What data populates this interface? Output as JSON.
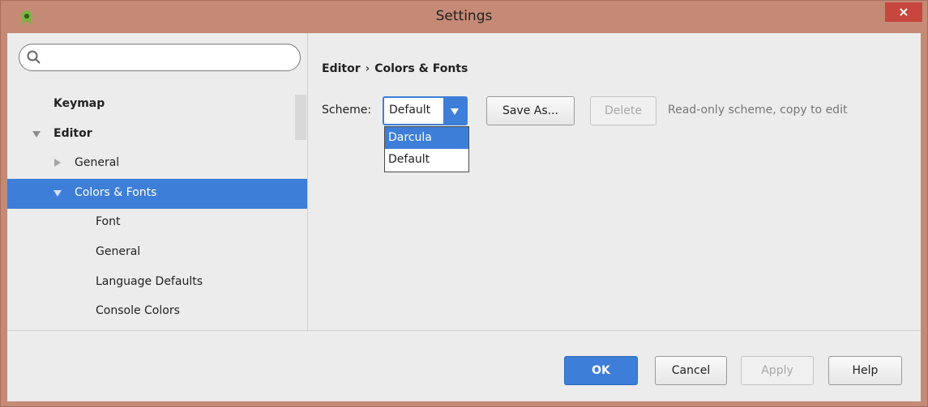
{
  "window": {
    "title": "Settings",
    "close_glyph": "×",
    "icon": "android-robot-icon"
  },
  "search": {
    "value": "",
    "placeholder": ""
  },
  "tree": {
    "keymap": "Keymap",
    "editor": "Editor",
    "general": "General",
    "colors_fonts": "Colors & Fonts",
    "font": "Font",
    "general2": "General",
    "language_defaults": "Language Defaults",
    "console_colors": "Console Colors"
  },
  "breadcrumb": {
    "parent": "Editor",
    "separator": "›",
    "current": "Colors & Fonts"
  },
  "scheme": {
    "label": "Scheme:",
    "selected": "Default",
    "options": [
      "Darcula",
      "Default"
    ],
    "highlighted": "Darcula"
  },
  "buttons": {
    "save_as": "Save As...",
    "delete": "Delete",
    "ok": "OK",
    "cancel": "Cancel",
    "apply": "Apply",
    "help": "Help"
  },
  "hint": "Read-only scheme, copy to edit",
  "colors": {
    "accent": "#3d7ed8",
    "frame": "#c58a76",
    "panel": "#ececec"
  }
}
